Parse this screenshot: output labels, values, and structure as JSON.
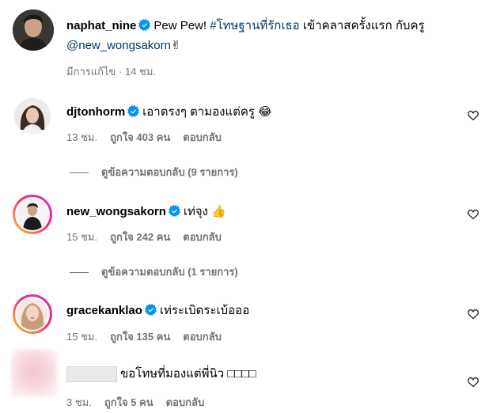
{
  "post": {
    "username": "naphat_nine",
    "caption_text": "Pew Pew! ",
    "hashtag": "#โทษฐานที่รักเธอ",
    "caption_rest": " เข้าคลาสครั้งแรก กับครู",
    "mention": "@new_wongsakorn",
    "mention_emoji": "✌",
    "edited_label": "มีการแก้ไข",
    "separator": " · ",
    "time": "14 ชม."
  },
  "comments": [
    {
      "username": "djtonhorm",
      "text": "เอาตรงๆ ตามองแต่ครู",
      "emoji": "😂",
      "time": "13 ชม.",
      "likes": "ถูกใจ 403 คน",
      "reply": "ตอบกลับ",
      "view_replies": "ดูข้อความตอบกลับ (9 รายการ)"
    },
    {
      "username": "new_wongsakorn",
      "text": "เท่จุง",
      "emoji": "👍",
      "time": "15 ชม.",
      "likes": "ถูกใจ 242 คน",
      "reply": "ตอบกลับ",
      "view_replies": "ดูข้อความตอบกลับ (1 รายการ)"
    },
    {
      "username": "gracekanklao",
      "text": "เท่ระเบิดระเบ้อออ",
      "time": "15 ชม.",
      "likes": "ถูกใจ 135 คน",
      "reply": "ตอบกลับ"
    },
    {
      "text": "ขอโทษที่มองแต่พี่นิว",
      "emoji": "□□□□",
      "time": "3 ชม.",
      "likes": "ถูกใจ 5 คน",
      "reply": "ตอบกลับ"
    }
  ],
  "colors": {
    "verified": "#0095f6",
    "link": "#00376b",
    "meta": "#737373"
  },
  "icons": [
    "verified-badge-icon",
    "heart-outline-icon"
  ]
}
